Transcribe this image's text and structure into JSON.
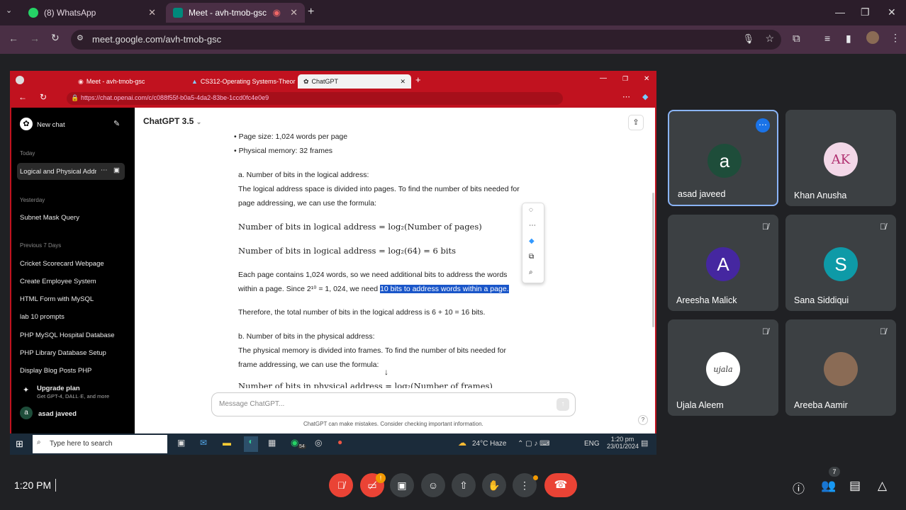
{
  "browser": {
    "tabs": [
      {
        "label": "(8) WhatsApp"
      },
      {
        "label": "Meet - avh-tmob-gsc"
      }
    ],
    "url": "meet.google.com/avh-tmob-gsc"
  },
  "inner": {
    "tabs": [
      {
        "label": "Meet - avh-tmob-gsc"
      },
      {
        "label": "CS312-Operating Systems-Theor"
      },
      {
        "label": "ChatGPT"
      }
    ],
    "url": "https://chat.openai.com/c/c088f55f-b0a5-4da2-83be-1ccd0fc4e0e9",
    "sidebar": {
      "new_chat": "New chat",
      "today": "Today",
      "active": "Logical and Physical Addr",
      "yesterday": "Yesterday",
      "y1": "Subnet Mask Query",
      "prev7": "Previous 7 Days",
      "items": [
        "Cricket Scorecard Webpage",
        "Create Employee System",
        "HTML Form with MySQL",
        "lab 10 prompts",
        "PHP MySQL Hospital Database",
        "PHP Library Database Setup",
        "Display Blog Posts PHP"
      ],
      "upgrade": "Upgrade plan",
      "upgrade_sub": "Get GPT-4, DALL·E, and more",
      "user": "asad javeed",
      "user_initial": "a"
    },
    "chat": {
      "model": "ChatGPT 3.5",
      "b1": "Page size: 1,024 words per page",
      "b2": "Physical memory: 32 frames",
      "a_head": "a. Number of bits in the logical address:",
      "a_p1": "The logical address space is divided into pages. To find the number of bits needed for",
      "a_p2": "page addressing, we can use the formula:",
      "f1": "Number of bits in logical address = log₂(Number of pages)",
      "f2": "Number of bits in logical address = log₂(64) = 6 bits",
      "e1": "Each page contains 1,024 words, so we need additional bits to address the words",
      "e2a": "within a page. Since 2¹⁰ = 1, 024, we need ",
      "e2b": "10 bits to address words within a page.",
      "t1": "Therefore, the total number of bits in the logical address is 6 + 10 = 16 bits.",
      "b_head": "b. Number of bits in the physical address:",
      "b_p1": "The physical memory is divided into frames. To find the number of bits needed for",
      "b_p2": "frame addressing, we can use the formula:",
      "f3": "Number of bits in physical address = log₂(Number of frames)",
      "placeholder": "Message ChatGPT...",
      "disclaimer": "ChatGPT can make mistakes. Consider checking important information.",
      "help": "?"
    },
    "taskbar": {
      "search": "Type here to search",
      "weather": "24°C  Haze",
      "lang": "ENG",
      "time": "1:20 pm",
      "date": "23/01/2024",
      "wa_badge": "54"
    }
  },
  "participants": [
    {
      "name": "asad javeed",
      "initial": "a",
      "color": "#1e4d3a",
      "muted": false
    },
    {
      "name": "Khan Anusha",
      "initial": "AK",
      "color": "#f3d8e8",
      "muted": false
    },
    {
      "name": "Areesha Malick",
      "initial": "A",
      "color": "#4527a0",
      "muted": true
    },
    {
      "name": "Sana Siddiqui",
      "initial": "S",
      "color": "#0e9aa7",
      "muted": true
    },
    {
      "name": "Ujala Aleem",
      "initial": "ujala",
      "color": "#ffffff",
      "muted": true
    },
    {
      "name": "Areeba Aamir",
      "initial": "",
      "color": "#8a6b55",
      "muted": true
    }
  ],
  "meet": {
    "time": "1:20 PM",
    "people_count": "7"
  }
}
